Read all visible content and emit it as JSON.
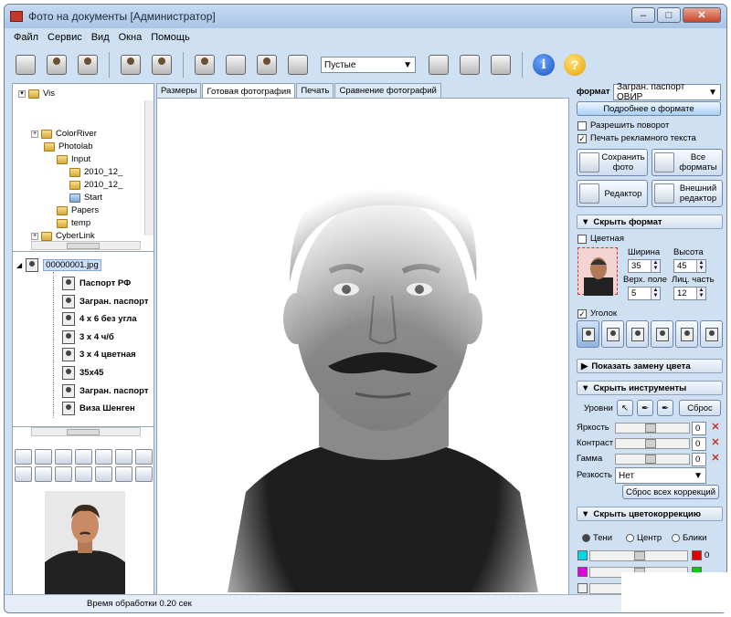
{
  "window": {
    "title": "Фото на документы  [Администратор]"
  },
  "menu": [
    "Файл",
    "Сервис",
    "Вид",
    "Окна",
    "Помощь"
  ],
  "toolbar": {
    "preset_value": "Пустые"
  },
  "tree": [
    {
      "label": "Vis",
      "indent": 0
    },
    {
      "label": "ColorRiver",
      "indent": 1
    },
    {
      "label": "Photolab",
      "indent": 2
    },
    {
      "label": "Input",
      "indent": 3
    },
    {
      "label": "2010_12_",
      "indent": 4
    },
    {
      "label": "2010_12_",
      "indent": 4
    },
    {
      "label": "Start",
      "indent": 4,
      "selected": true
    },
    {
      "label": "Papers",
      "indent": 3
    },
    {
      "label": "temp",
      "indent": 3
    },
    {
      "label": "CyberLink",
      "indent": 1
    }
  ],
  "files": {
    "root": "00000001.jpg",
    "formats": [
      "Паспорт РФ",
      "Загран. паспорт",
      "4 x 6 без угла",
      "3 x 4 ч/б",
      "3 x 4 цветная",
      "35x45",
      "Загран. паспорт",
      "Виза Шенген"
    ]
  },
  "tabs": [
    "Размеры",
    "Готовая фотография",
    "Печать",
    "Сравнение фотографий"
  ],
  "active_tab": 1,
  "right": {
    "format_label": "формат",
    "format_value": "Загран. паспорт ОВИР",
    "more_button": "Подробнее о формате",
    "allow_rotate": "Разрешить поворот",
    "print_ad": "Печать рекламного текста",
    "save_photo": "Сохранить фото",
    "all_formats": "Все форматы",
    "editor": "Редактор",
    "ext_editor": "Внешний редактор",
    "hide_format": "Скрыть формат",
    "color_label": "Цветная",
    "width_label": "Ширина",
    "height_label": "Высота",
    "width_value": "35",
    "height_value": "45",
    "top_field_label": "Верх. поле",
    "face_part_label": "Лиц. часть",
    "top_field_value": "5",
    "face_part_value": "12",
    "corner_label": "Уголок",
    "show_color_replace": "Показать замену цвета",
    "hide_tools": "Скрыть инструменты",
    "levels_label": "Уровни",
    "reset": "Сброс",
    "brightness": "Яркость",
    "contrast": "Контраст",
    "gamma": "Гамма",
    "sharpness": "Резкость",
    "sharpness_value": "Нет",
    "zero": "0",
    "reset_all": "Сброс всех коррекций",
    "hide_color_corr": "Скрыть цветокоррекцию",
    "shadows": "Тени",
    "center": "Центр",
    "highlights": "Блики"
  },
  "status": "Время обработки 0.20 сек",
  "colors": {
    "cyan": "#00d8e6",
    "red": "#e00000",
    "magenta": "#e000e0",
    "green": "#00d000"
  }
}
